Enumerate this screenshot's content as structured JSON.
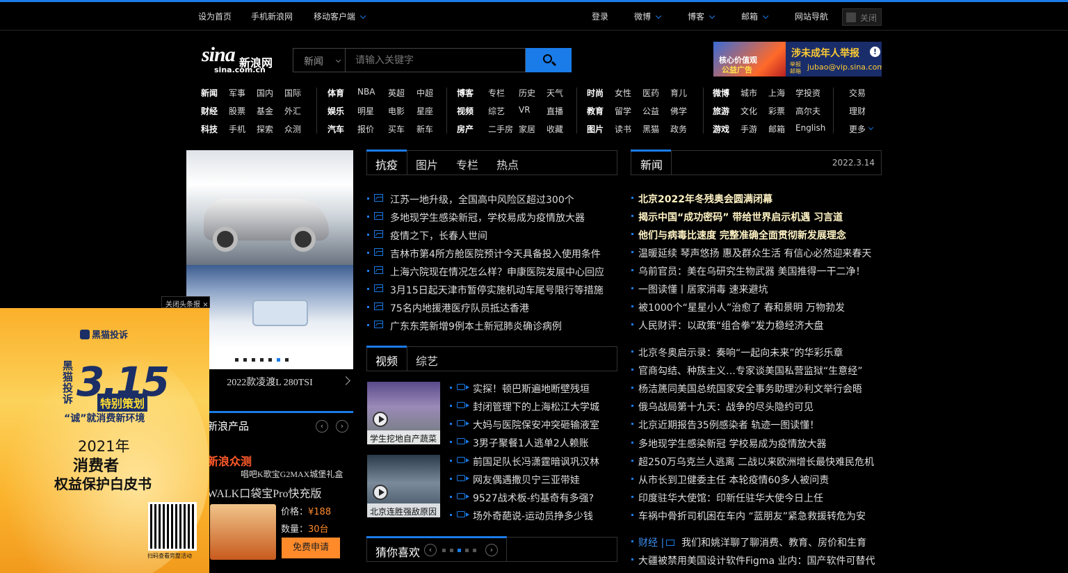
{
  "topbar": {
    "left": [
      "设为首页",
      "手机新浪网",
      "移动客户端"
    ],
    "right": [
      "登录",
      "微博",
      "博客",
      "邮箱",
      "网站导航"
    ],
    "close": "关闭"
  },
  "logo": {
    "brand": "sina",
    "name": "新浪网",
    "domain": "sina.com.cn"
  },
  "search": {
    "category": "新闻",
    "placeholder": "请输入关键字"
  },
  "ad_top": {
    "line1": "核心价值观",
    "line2": "公益广告",
    "title": "涉未成年人举报",
    "small": "举报邮箱",
    "email": "jubao@vip.sina.com"
  },
  "nav": [
    [
      "新闻",
      "军事",
      "国内",
      "国际"
    ],
    [
      "财经",
      "股票",
      "基金",
      "外汇"
    ],
    [
      "科技",
      "手机",
      "探索",
      "众测"
    ],
    [
      "体育",
      "NBA",
      "英超",
      "中超"
    ],
    [
      "娱乐",
      "明星",
      "电影",
      "星座"
    ],
    [
      "汽车",
      "报价",
      "买车",
      "新车"
    ],
    [
      "博客",
      "专栏",
      "历史",
      "天气"
    ],
    [
      "视频",
      "综艺",
      "VR",
      "直播"
    ],
    [
      "房产",
      "二手房",
      "家居",
      "收藏"
    ],
    [
      "时尚",
      "女性",
      "医药",
      "育儿"
    ],
    [
      "教育",
      "留学",
      "公益",
      "佛学"
    ],
    [
      "图片",
      "读书",
      "黑猫",
      "政务"
    ],
    [
      "微博",
      "城市",
      "上海",
      "学投资"
    ],
    [
      "旅游",
      "文化",
      "彩票",
      "高尔夫"
    ],
    [
      "游戏",
      "手游",
      "邮箱",
      "English"
    ],
    [
      "交易"
    ],
    [
      "理财"
    ],
    [
      "更多"
    ]
  ],
  "carousel": {
    "caption": "2022款凌渡L 280TSI",
    "active_dot": 5,
    "dots": 7
  },
  "products": {
    "title": "新浪产品",
    "red": "新浪众测",
    "sub": "唱吧K歌宝G2MAX城堡礼盒",
    "name": "WALK口袋宝Pro快充版",
    "price_label": "价格：",
    "price": "¥188",
    "qty_label": "数量：",
    "qty": "30台",
    "apply": "免费申请"
  },
  "float_ad": {
    "close": "关闭头条报",
    "brand": "黑猫投诉",
    "vertical": "黑猫投诉",
    "big": "3.15",
    "special": "特别策划",
    "slogan": "“诚”就消费新环境",
    "year": "2021年",
    "line1": "消费者",
    "line2": "权益保护白皮书",
    "qr_caption": "扫码查看完整活动"
  },
  "mid_tabs": [
    "抗疫",
    "图片",
    "专栏",
    "热点"
  ],
  "mid_news": [
    "江苏一地升级，全国高中风险区超过300个",
    "多地现学生感染新冠，学校易成为疫情放大器",
    "疫情之下，长春人世间",
    "吉林市第4所方舱医院预计今天具备投入使用条件",
    "上海六院现在情况怎么样？申康医院发展中心回应",
    "3月15日起天津市暂停实施机动车尾号限行等措施",
    "75名内地援港医疗队员抵达香港",
    "广东东莞新增9例本土新冠肺炎确诊病例"
  ],
  "video_tabs": [
    "视频",
    "综艺"
  ],
  "video_thumbs": [
    "学生挖地自产蔬菜",
    "北京连胜强敌原因"
  ],
  "video_news": [
    "实探！顿巴斯遍地断壁残垣",
    "封闭管理下的上海松江大学城",
    "大妈与医院保安冲突砸输液室",
    "3男子聚餐1人逃单2人赖账",
    "前国足队长冯潇霆暗讽巩汉林",
    "网友偶遇撒贝宁三亚带娃",
    "9527战术板-约基奇有多强?",
    "场外奇葩说-运动员挣多少钱"
  ],
  "guess": {
    "title": "猜你喜欢",
    "dots": 5,
    "active_dot": 2
  },
  "right": {
    "tab": "新闻",
    "date": "2022.3.14",
    "headlines": [
      "北京2022年冬残奥会圆满闭幕",
      "揭示中国“成功密码” 带给世界启示机遇 习言道",
      "他们与病毒比速度 完整准确全面贯彻新发展理念"
    ],
    "news1": [
      "温暖延续 琴声悠扬 惠及群众生活 有信心必然迎来春天",
      "乌前官员：美在乌研究生物武器 美国推得一干二净！",
      "一图读懂丨居家消毒 速来避坑",
      "被1000个“星星小人”治愈了 春和景明 万物勃发",
      "人民财评：以政策“组合拳”发力稳经济大盘"
    ],
    "news2": [
      "北京冬奥启示录：奏响“一起向未来”的华彩乐章",
      "官商勾结、种族主义…专家谈美国私营监狱“生意经”",
      "杨洁篪同美国总统国家安全事务助理沙利文举行会晤",
      "俄乌战局第十九天：战争的尽头隐约可见",
      "北京近期报告35例感染者 轨迹一图读懂！",
      "多地现学生感染新冠 学校易成为疫情放大器",
      "超250万乌克兰人逃离 二战以来欧洲增长最快难民危机",
      "从市长到卫健委主任 本轮疫情60多人被问责",
      "印度驻华大使馆：印新任驻华大使今日上任",
      "车祸中骨折司机困在车内 “蓝朋友”紧急救援转危为安"
    ],
    "finance_label": "财经 |",
    "finance": "我们和姚洋聊了聊消费、教育、房价和生育",
    "last": "大疆被禁用美国设计软件Figma 业内：国产软件可替代"
  }
}
